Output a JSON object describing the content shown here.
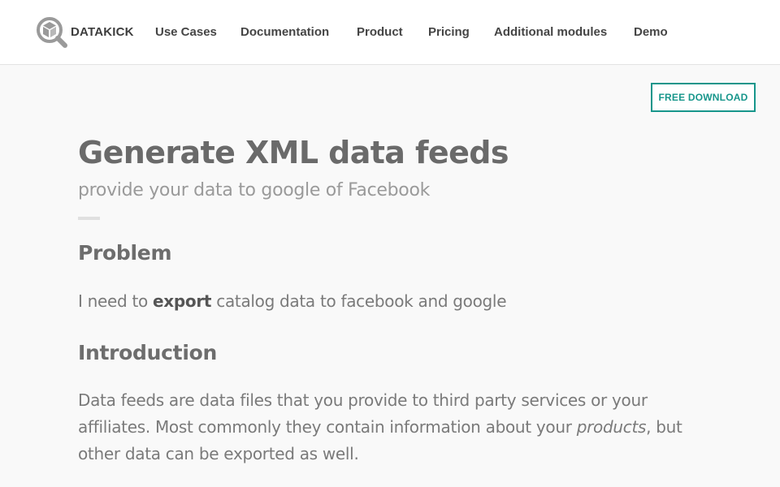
{
  "header": {
    "brand": "DATAKICK",
    "logo_icon": "magnifier-cube-icon",
    "nav": [
      {
        "label": "Use Cases"
      },
      {
        "label": "Documentation"
      },
      {
        "label": "Product"
      },
      {
        "label": "Pricing"
      },
      {
        "label": "Additional modules"
      },
      {
        "label": "Demo"
      }
    ]
  },
  "cta": {
    "free_download_label": "FREE DOWNLOAD"
  },
  "content": {
    "title": "Generate XML data feeds",
    "subtitle": "provide your data to google of Facebook",
    "problem": {
      "heading": "Problem",
      "text_before": "I need to ",
      "text_strong": "export",
      "text_after": " catalog data to facebook and google"
    },
    "introduction": {
      "heading": "Introduction",
      "text_before": "Data feeds are data files that you provide to third party services or your affiliates. Most commonly they contain information about your ",
      "text_em": "products",
      "text_after": ", but other data can be exported as well."
    }
  },
  "colors": {
    "accent": "#17968b",
    "logo": "#9a9a9a",
    "text": "#6b6b6b",
    "background": "#f9f9f9"
  }
}
